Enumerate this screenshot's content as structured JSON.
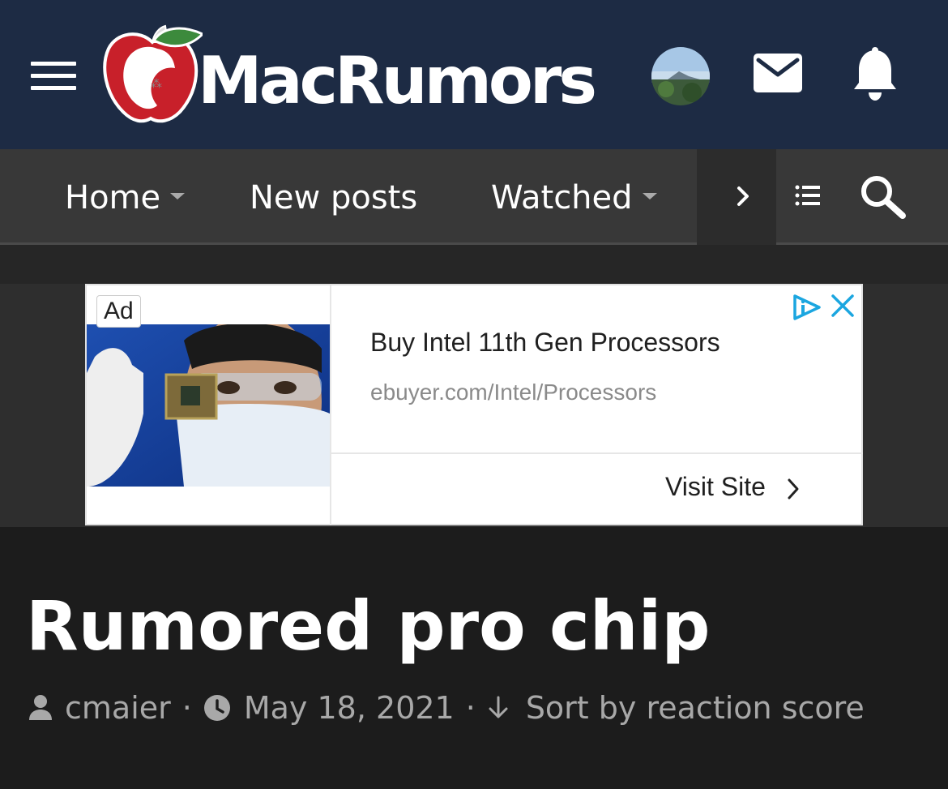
{
  "header": {
    "logo_text": "MacRumors",
    "colors": {
      "header_bg": "#1d2b44",
      "logo_red": "#c8202a",
      "logo_green": "#3c8a3c"
    }
  },
  "nav": {
    "items": [
      {
        "label": "Home",
        "has_dropdown": true
      },
      {
        "label": "New posts",
        "has_dropdown": false
      },
      {
        "label": "Watched",
        "has_dropdown": true
      }
    ],
    "icons": [
      "hamburger-icon",
      "chevron-right-icon",
      "list-icon",
      "search-icon",
      "mail-icon",
      "bell-icon"
    ]
  },
  "ad": {
    "badge": "Ad",
    "title": "Buy Intel 11th Gen Processors",
    "url": "ebuyer.com/Intel/Processors",
    "cta": "Visit Site"
  },
  "thread": {
    "title": "Rumored pro chip",
    "author": "cmaier",
    "date": "May 18, 2021",
    "sort_label": "Sort by reaction score",
    "separator": "·"
  }
}
